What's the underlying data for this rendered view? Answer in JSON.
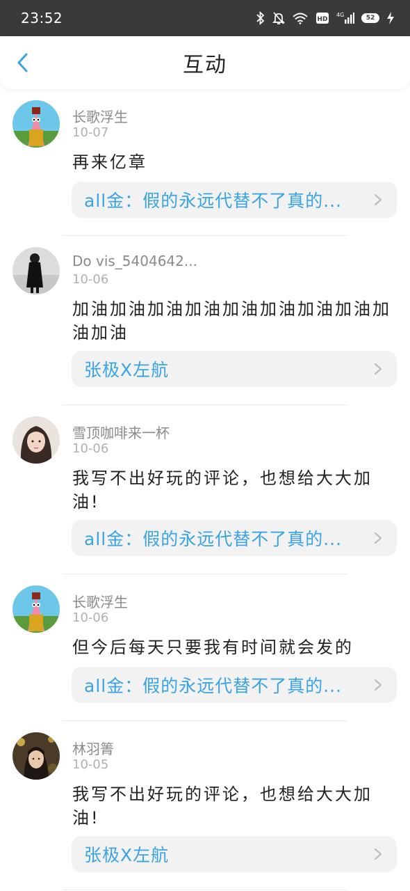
{
  "status_bar": {
    "time": "23:52",
    "battery": "52"
  },
  "header": {
    "title": "互动"
  },
  "items": [
    {
      "user": "长歌浮生",
      "date": "10-07",
      "content": "再来亿章",
      "ref": "all金：假的永远代替不了真的..."
    },
    {
      "user": "Do vis_5404642...",
      "date": "10-06",
      "content": "加油加油加油加油加油加油加油加油加油加油",
      "ref": "张极X左航"
    },
    {
      "user": "雪顶咖啡来一杯",
      "date": "10-06",
      "content": "我写不出好玩的评论，也想给大大加油!",
      "ref": "all金：假的永远代替不了真的..."
    },
    {
      "user": "长歌浮生",
      "date": "10-06",
      "content": "但今后每天只要我有时间就会发的",
      "ref": "all金：假的永远代替不了真的..."
    },
    {
      "user": "林羽箐",
      "date": "10-05",
      "content": "我写不出好玩的评论，也想给大大加油!",
      "ref": "张极X左航"
    }
  ],
  "colors": {
    "accent": "#3aa3e3",
    "status_bar": "#3a3a3a",
    "ref_background": "#f2f2f2"
  }
}
